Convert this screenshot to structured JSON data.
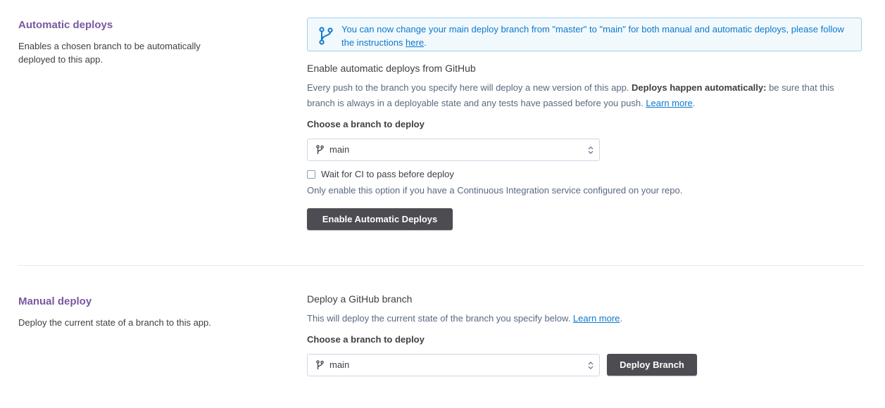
{
  "automatic": {
    "title": "Automatic deploys",
    "description": "Enables a chosen branch to be automatically deployed to this app.",
    "notice": {
      "text_before": "You can now change your main deploy branch from \"master\" to \"main\" for both manual and automatic deploys, please follow the instructions ",
      "link": "here",
      "text_after": "."
    },
    "heading": "Enable automatic deploys from GitHub",
    "body_before": "Every push to the branch you specify here will deploy a new version of this app. ",
    "body_bold": "Deploys happen automatically:",
    "body_after": " be sure that this branch is always in a deployable state and any tests have passed before you push. ",
    "learn_more": "Learn more",
    "period": ".",
    "branch_label": "Choose a branch to deploy",
    "branch_value": "main",
    "ci_checkbox_label": "Wait for CI to pass before deploy",
    "ci_checked": false,
    "ci_help": "Only enable this option if you have a Continuous Integration service configured on your repo.",
    "enable_button": "Enable Automatic Deploys"
  },
  "manual": {
    "title": "Manual deploy",
    "description": "Deploy the current state of a branch to this app.",
    "heading": "Deploy a GitHub branch",
    "body": "This will deploy the current state of the branch you specify below. ",
    "learn_more": "Learn more",
    "period": ".",
    "branch_label": "Choose a branch to deploy",
    "branch_value": "main",
    "deploy_button": "Deploy Branch"
  },
  "icons": {
    "notice_icon": "git-branch-icon",
    "select_icon": "git-branch-icon",
    "select_chevron": "chevron-up-down-icon"
  },
  "colors": {
    "section_title": "#79589f",
    "notice_text": "#0b79ce",
    "notice_bg": "#f2f9fd",
    "notice_border": "#9fd0ea",
    "button_bg": "#4c4c52"
  }
}
